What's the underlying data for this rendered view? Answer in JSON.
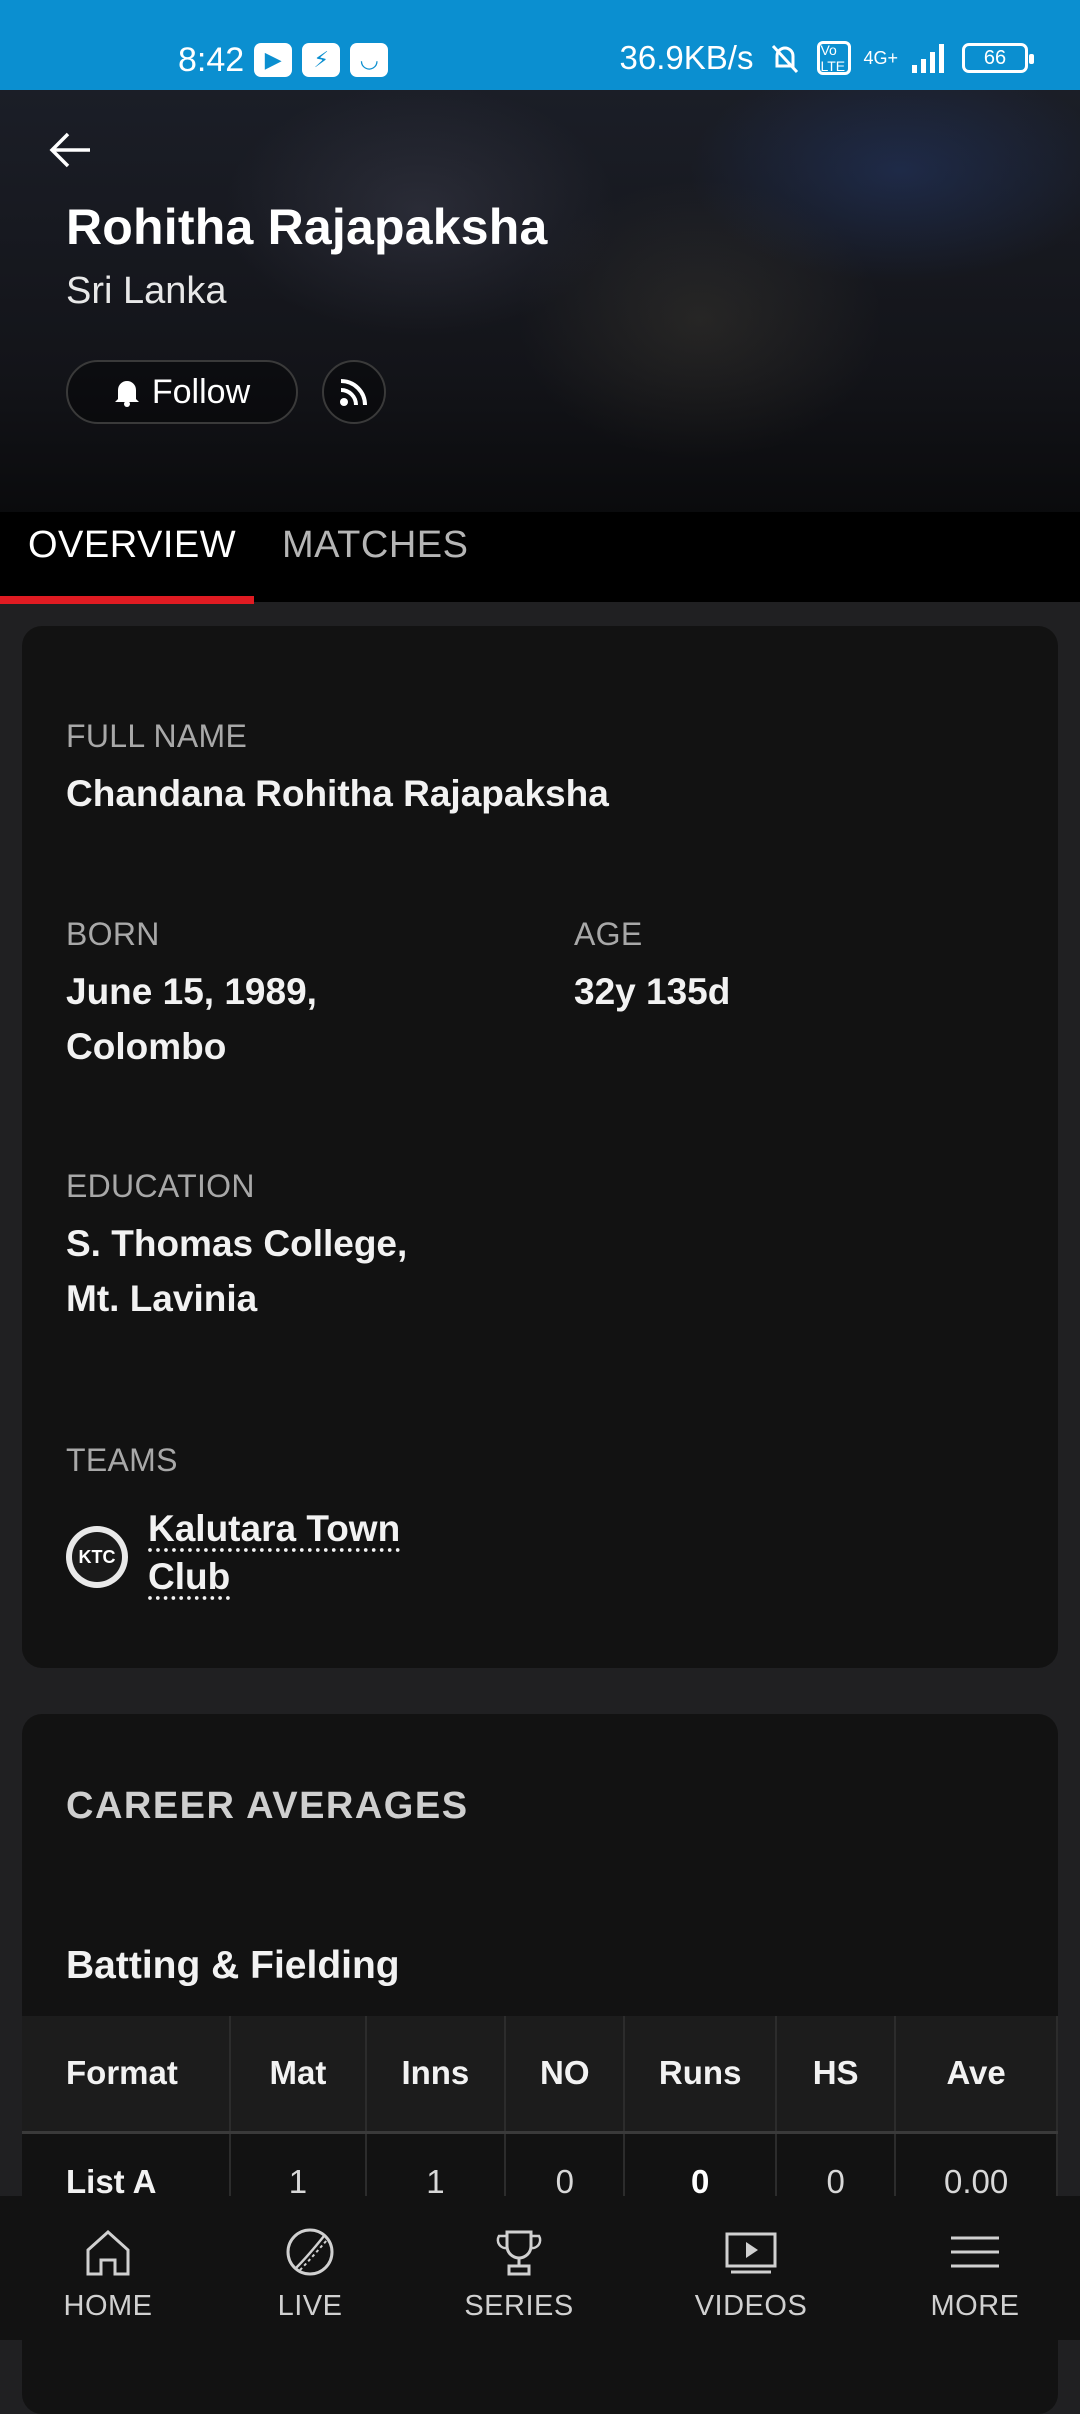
{
  "status_bar": {
    "time": "8:42",
    "speed": "36.9KB/s",
    "volte": "Vo LTE",
    "network": "4G+",
    "battery": "66"
  },
  "header": {
    "player_name": "Rohitha Rajapaksha",
    "country": "Sri Lanka",
    "follow_label": "Follow"
  },
  "tabs": [
    {
      "label": "OVERVIEW",
      "active": true
    },
    {
      "label": "MATCHES",
      "active": false
    }
  ],
  "profile": {
    "full_name_label": "FULL NAME",
    "full_name": "Chandana Rohitha Rajapaksha",
    "born_label": "BORN",
    "born_line1": "June 15, 1989,",
    "born_line2": "Colombo",
    "age_label": "AGE",
    "age": "32y 135d",
    "education_label": "EDUCATION",
    "education_line1": "S. Thomas College,",
    "education_line2": "Mt. Lavinia",
    "teams_label": "TEAMS",
    "team_name_line1": "Kalutara Town",
    "team_name_line2": "Club",
    "team_logo_text": "KTC"
  },
  "career": {
    "title": "CAREER AVERAGES",
    "subtitle": "Batting & Fielding",
    "columns": [
      "Format",
      "Mat",
      "Inns",
      "NO",
      "Runs",
      "HS",
      "Ave"
    ],
    "rows": [
      [
        "List A",
        "1",
        "1",
        "0",
        "0",
        "0",
        "0.00"
      ]
    ]
  },
  "bottom_nav": [
    {
      "label": "HOME"
    },
    {
      "label": "LIVE"
    },
    {
      "label": "SERIES"
    },
    {
      "label": "VIDEOS"
    },
    {
      "label": "MORE"
    }
  ],
  "colors": {
    "accent_red": "#e01b22",
    "status_bar_blue": "#0b8fd0",
    "card_bg": "#121212"
  }
}
